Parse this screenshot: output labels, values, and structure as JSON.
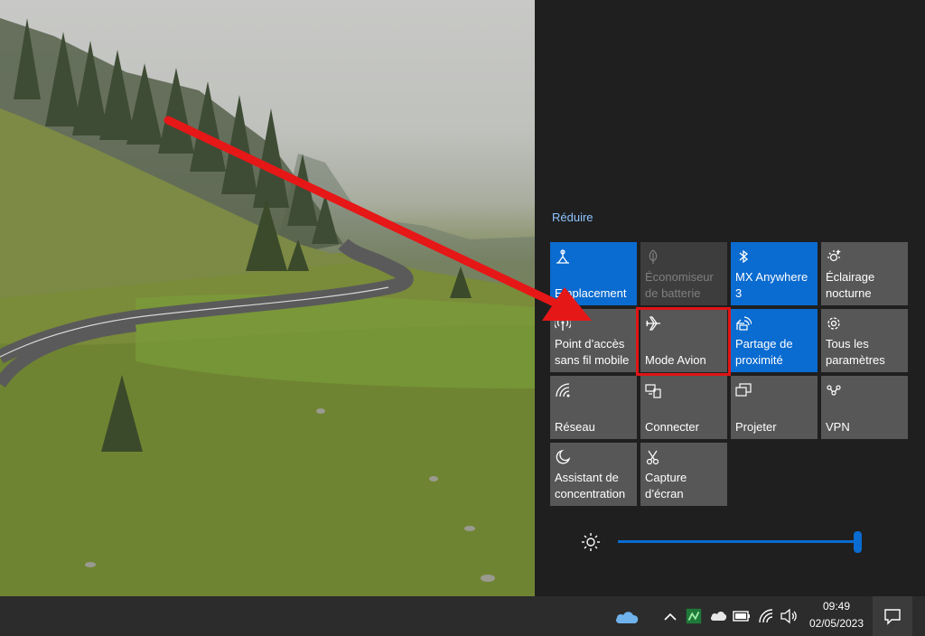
{
  "action_center": {
    "collapse_label": "Réduire",
    "tiles": [
      {
        "id": "location",
        "label": "Emplacement",
        "state": "on",
        "icon": "location-icon"
      },
      {
        "id": "battery-saver",
        "label": "Économiseur\nde batterie",
        "state": "disabled",
        "icon": "battery-leaf-icon"
      },
      {
        "id": "bluetooth",
        "label": "MX Anywhere\n3",
        "state": "on",
        "icon": "bluetooth-icon"
      },
      {
        "id": "night-light",
        "label": "Éclairage\nnocturne",
        "state": "off",
        "icon": "night-light-icon"
      },
      {
        "id": "mobile-hotspot",
        "label": "Point d’accès\nsans fil mobile",
        "state": "off",
        "icon": "hotspot-icon"
      },
      {
        "id": "airplane-mode",
        "label": "Mode Avion",
        "state": "off",
        "icon": "airplane-icon"
      },
      {
        "id": "nearby-sharing",
        "label": "Partage de\nproximité",
        "state": "on",
        "icon": "nearby-share-icon"
      },
      {
        "id": "all-settings",
        "label": "Tous les\nparamètres",
        "state": "off",
        "icon": "gear-icon"
      },
      {
        "id": "network",
        "label": "Réseau",
        "state": "off",
        "icon": "wifi-icon"
      },
      {
        "id": "connect",
        "label": "Connecter",
        "state": "off",
        "icon": "connect-icon"
      },
      {
        "id": "project",
        "label": "Projeter",
        "state": "off",
        "icon": "project-icon"
      },
      {
        "id": "vpn",
        "label": "VPN",
        "state": "off",
        "icon": "vpn-icon"
      },
      {
        "id": "focus-assist",
        "label": "Assistant de\nconcentration",
        "state": "off",
        "icon": "moon-icon"
      },
      {
        "id": "screen-snip",
        "label": "Capture\nd’écran",
        "state": "off",
        "icon": "snip-icon"
      }
    ],
    "brightness": {
      "value": 1.0
    }
  },
  "taskbar": {
    "time": "09:49",
    "date": "02/05/2023"
  },
  "colors": {
    "accent": "#0a6bd0",
    "highlight": "#e01414"
  }
}
